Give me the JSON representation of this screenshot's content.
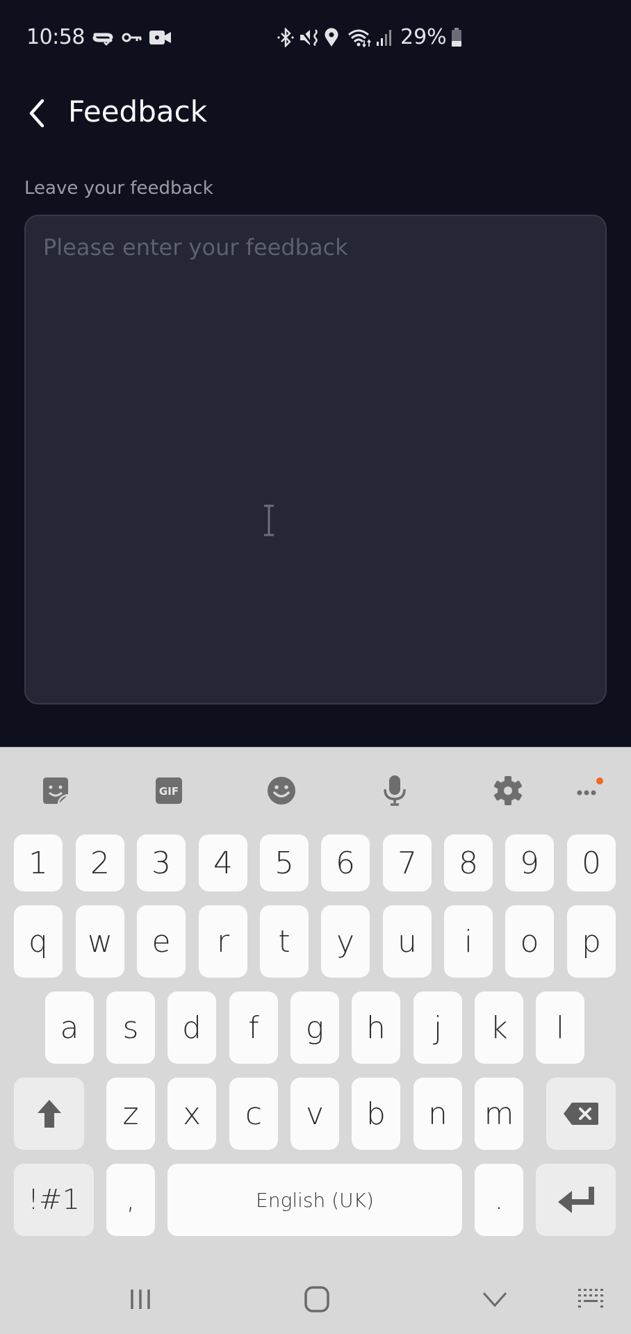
{
  "status_bar": {
    "time": "10:58",
    "left_icons": [
      "cloud-sync-icon",
      "vpn-key-icon",
      "screen-record-icon"
    ],
    "right_icons": [
      "bluetooth-icon",
      "mute-vibrate-icon",
      "location-icon",
      "wifi-icon",
      "signal-icon"
    ],
    "battery_percent": "29%",
    "battery_level": 0.29
  },
  "header": {
    "back_icon": "chevron-left-icon",
    "title": "Feedback"
  },
  "form": {
    "label": "Leave your feedback",
    "textarea": {
      "value": "",
      "placeholder": "Please enter your feedback"
    }
  },
  "keyboard": {
    "toolbar": [
      {
        "name": "sticker-icon"
      },
      {
        "name": "gif-icon",
        "label": "GIF"
      },
      {
        "name": "emoji-icon"
      },
      {
        "name": "voice-input-icon"
      },
      {
        "name": "settings-icon"
      },
      {
        "name": "more-options-icon",
        "badge_color": "#f06a1d"
      }
    ],
    "rows": {
      "numbers": [
        "1",
        "2",
        "3",
        "4",
        "5",
        "6",
        "7",
        "8",
        "9",
        "0"
      ],
      "row1": [
        "q",
        "w",
        "e",
        "r",
        "t",
        "y",
        "u",
        "i",
        "o",
        "p"
      ],
      "row2": [
        "a",
        "s",
        "d",
        "f",
        "g",
        "h",
        "j",
        "k",
        "l"
      ],
      "row3": [
        "z",
        "x",
        "c",
        "v",
        "b",
        "n",
        "m"
      ]
    },
    "symbols_key": "!#1",
    "comma_key": ",",
    "space_label": "English (UK)",
    "period_key": ".",
    "shift_icon": "shift-arrow-icon",
    "backspace_icon": "backspace-icon",
    "enter_icon": "enter-icon"
  },
  "nav_bar": {
    "buttons": [
      "recent-apps-icon",
      "home-icon",
      "hide-keyboard-icon",
      "keyboard-switch-icon"
    ]
  },
  "colors": {
    "background": "#0e111d",
    "input_bg": "#252736",
    "keyboard_bg": "#d8d8d8",
    "key_bg": "#fbfbfb",
    "accent_badge": "#f06a1d"
  }
}
